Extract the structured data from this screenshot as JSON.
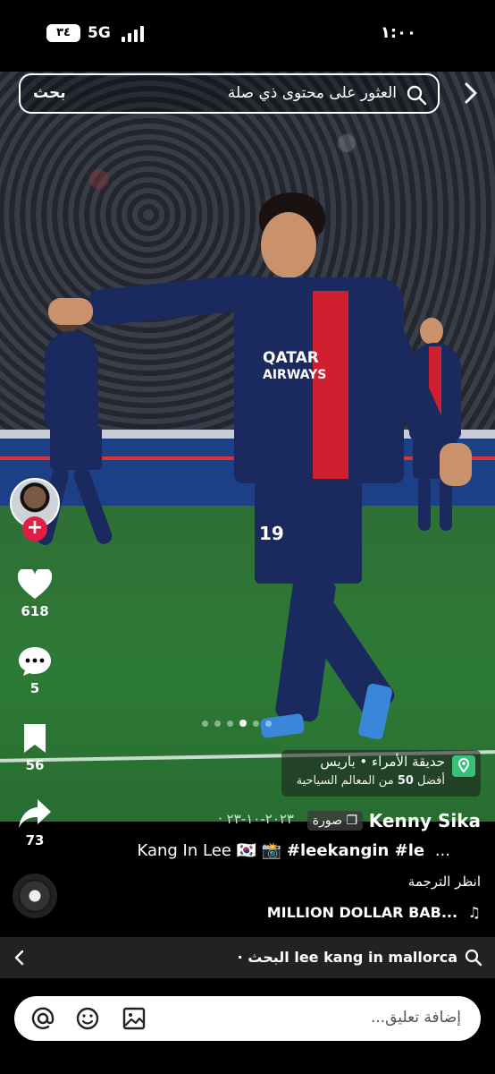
{
  "status_bar": {
    "time": "١:٠٠",
    "network": "5G",
    "battery": "٣٤"
  },
  "search": {
    "placeholder_text": "العثور على محتوى ذي صلة",
    "button_label": "بحث"
  },
  "photo": {
    "sponsor_line1": "QATAR",
    "sponsor_line2": "AIRWAYS",
    "shirt_number": "19"
  },
  "carousel": {
    "total": 6,
    "active_index": 3
  },
  "location": {
    "name": "حديقة الأمراء • باريس",
    "subtitle_prefix": "أفضل",
    "subtitle_number": "50",
    "subtitle_suffix": "من المعالم السياحية"
  },
  "actions": {
    "likes": "618",
    "comments": "5",
    "saves": "56",
    "shares": "73"
  },
  "post": {
    "author": "Kenny Sika",
    "type": "صورة",
    "date": "٢٠٢٣-١٠-٢٣ ·",
    "caption_name": "Kang In Lee",
    "caption_flag": "🇰🇷",
    "caption_camera": "📸",
    "caption_tags": "#leekangin #le",
    "caption_more": "...",
    "see_translation": "انظر الترجمة",
    "music": "MILLION DOLLAR BAB..."
  },
  "related": {
    "prefix": "البحث ·",
    "query": "lee kang in mallorca"
  },
  "comment": {
    "placeholder": "إضافة تعليق..."
  },
  "colors": {
    "accent_red": "#e21d48",
    "location_green": "#37c07a",
    "related_bg": "#222222"
  }
}
